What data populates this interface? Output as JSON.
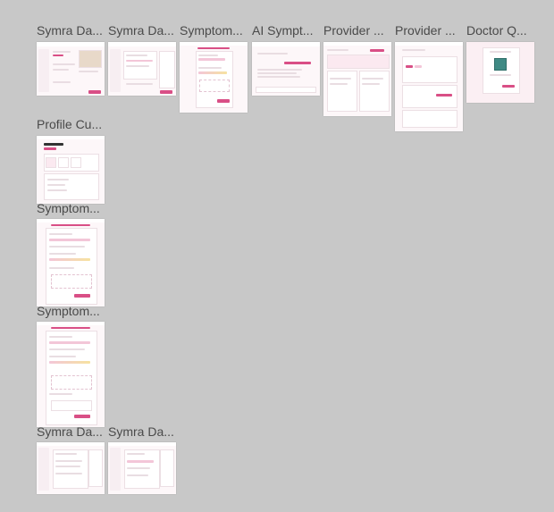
{
  "canvas": {
    "background": "#c8c8c8",
    "accent": "#d94f86",
    "frames": [
      {
        "id": "f1",
        "title": "Symra Da..."
      },
      {
        "id": "f2",
        "title": "Symra Da..."
      },
      {
        "id": "f3",
        "title": "Symptom..."
      },
      {
        "id": "f4",
        "title": "AI Sympt..."
      },
      {
        "id": "f5",
        "title": "Provider ..."
      },
      {
        "id": "f6",
        "title": "Provider ..."
      },
      {
        "id": "f7",
        "title": "Doctor Q..."
      },
      {
        "id": "f8",
        "title": "Profile Cu..."
      },
      {
        "id": "f9",
        "title": "Symptom..."
      },
      {
        "id": "f10",
        "title": "Symptom..."
      },
      {
        "id": "f11",
        "title": "Symra Da..."
      },
      {
        "id": "f12",
        "title": "Symra Da..."
      }
    ]
  }
}
